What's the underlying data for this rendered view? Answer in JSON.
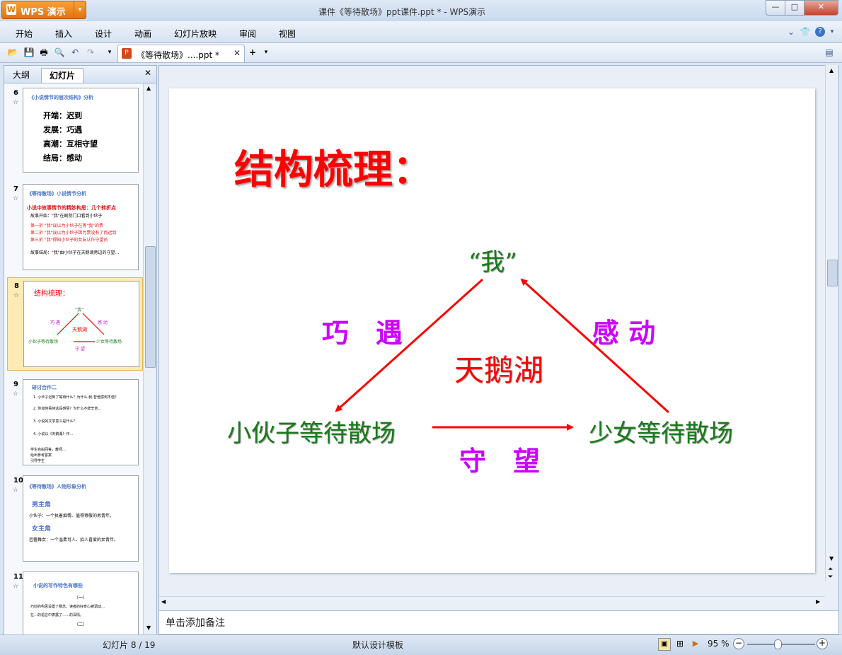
{
  "app": {
    "name": "WPS 演示",
    "window_title": "课件《等待散场》ppt课件.ppt *  -  WPS演示"
  },
  "menu": [
    "开始",
    "插入",
    "设计",
    "动画",
    "幻灯片放映",
    "审阅",
    "视图"
  ],
  "document_tab": {
    "name": "《等待散场》....ppt *"
  },
  "left_pane": {
    "tabs": [
      "大纲",
      "幻灯片"
    ],
    "slides": [
      {
        "num": "6",
        "title": "《小说情节的层次结构》分析",
        "lines": [
          "开端：迟到",
          "发展：巧遇",
          "高潮：互相守望",
          "结局：感动"
        ]
      },
      {
        "num": "7",
        "title": "《等待散场》小说情节分析",
        "lines": [
          "小说中故事情节的精妙构思：几个转折点",
          "故事开始：\"我\"在剧院门口看到小伙子",
          "第一折 \"我\"误以为小伙子在等\"我\"的票",
          "第二折 \"我\"误以为小伙子因为票没有了而迟到",
          "第三折 \"我\"得知小伙子的女友认作守望员",
          "故事结局：\"我\"由小伙子在天鹅湖旁边的守望…"
        ]
      },
      {
        "num": "8",
        "title": "结构梳理：",
        "selected": true
      },
      {
        "num": "9",
        "title": "研讨合作二",
        "lines": [
          "1. 小伙子迟到了等待什么？为什么-我-替他感到不值？",
          "2. 你如何看待这段感情？为什么不辞辛苦…",
          "3. 小说的文学意义是什么？",
          "4. 小说以《天鹅湖》作…",
          "学生自由回答，教师…",
          "给出参考答案",
          "引导学生"
        ]
      },
      {
        "num": "10",
        "title": "《等待散场》人物形象分析",
        "lines": [
          "男主角",
          "小伙子：一个执着痴情、值得尊敬的男青年。",
          "女主角",
          "芭蕾舞女：一个温柔可人、招人喜爱的女青年。"
        ]
      },
      {
        "num": "11",
        "title": "小说的写作特色有哪些",
        "lines": [
          "（一）",
          "巧妙的构思设置了悬念，读者的好奇心被调动…",
          "在…的语言中表露了……的深情。",
          "（二）"
        ]
      }
    ]
  },
  "slide": {
    "title": "结构梳理：",
    "center": "天鹅湖",
    "top_node": "“我”",
    "left_node": "小伙子等待散场",
    "right_node": "少女等待散场",
    "left_edge_label": "巧　遇",
    "right_edge_label": "感 动",
    "bottom_edge_label": "守　望"
  },
  "notes_placeholder": "单击添加备注",
  "status": {
    "slide_counter": "幻灯片 8 / 19",
    "template": "默认设计模板",
    "zoom": "95 %"
  },
  "colors": {
    "title_red": "#ff0000",
    "node_green": "#1a7a1a",
    "label_purple": "#cc00ff",
    "arrow_red": "#ff0000"
  }
}
